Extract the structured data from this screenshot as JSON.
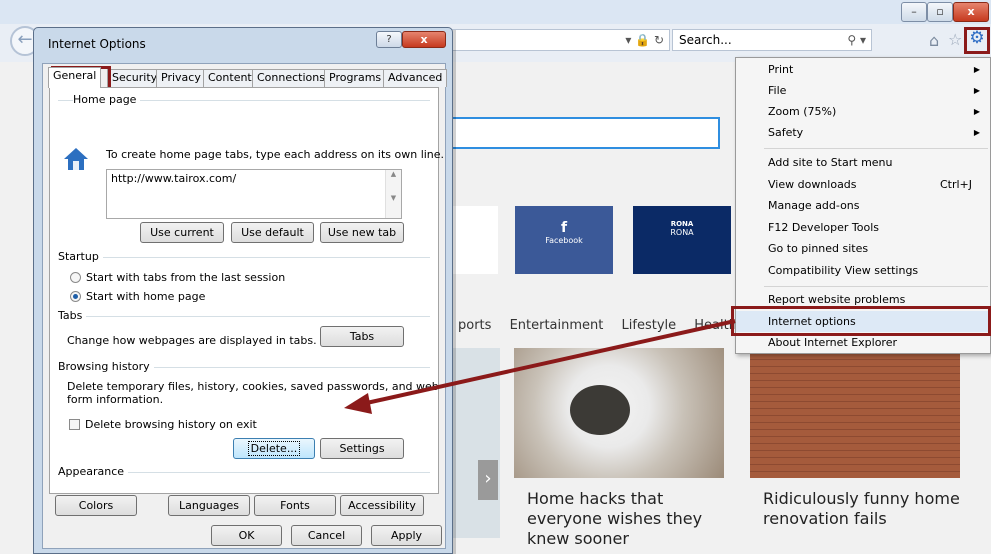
{
  "browser": {
    "window_controls": {
      "minimize": "–",
      "maximize": "▫",
      "close": "x"
    },
    "search_placeholder": "Search...",
    "address_controls": "▾ 🔒 ↻",
    "search_glyph": "⚲ ▾"
  },
  "page": {
    "tiles": [
      {
        "title": "f",
        "label": "Facebook",
        "color": "#3b5998"
      },
      {
        "title": "RONA",
        "label": "RONA",
        "color": "#0b2a66"
      }
    ],
    "categories": [
      "ports",
      "Entertainment",
      "Lifestyle",
      "Health"
    ],
    "cards": [
      {
        "headline": "Home hacks that everyone wishes they knew sooner"
      },
      {
        "headline": "Ridiculously funny home renovation fails"
      }
    ],
    "carousel_arrow": "›"
  },
  "tools_menu": {
    "items": [
      {
        "label": "Print",
        "submenu": true
      },
      {
        "label": "File",
        "submenu": true
      },
      {
        "label": "Zoom (75%)",
        "submenu": true
      },
      {
        "label": "Safety",
        "submenu": true
      },
      {
        "label": "Add site to Start menu"
      },
      {
        "label": "View downloads",
        "shortcut": "Ctrl+J"
      },
      {
        "label": "Manage add-ons"
      },
      {
        "label": "F12 Developer Tools"
      },
      {
        "label": "Go to pinned sites"
      },
      {
        "label": "Compatibility View settings"
      },
      {
        "label": "Report website problems"
      },
      {
        "label": "Internet options",
        "highlighted": true
      },
      {
        "label": "About Internet Explorer"
      }
    ],
    "arrow_glyph": "▶"
  },
  "dialog": {
    "title": "Internet Options",
    "help": "?",
    "close": "x",
    "tabs": [
      "General",
      "Security",
      "Privacy",
      "Content",
      "Connections",
      "Programs",
      "Advanced"
    ],
    "active_tab": "General",
    "home_page": {
      "group_title": "Home page",
      "instruction": "To create home page tabs, type each address on its own line.",
      "value": "http://www.tairox.com/",
      "buttons": [
        "Use current",
        "Use default",
        "Use new tab"
      ]
    },
    "startup": {
      "group_title": "Startup",
      "options": [
        "Start with tabs from the last session",
        "Start with home page"
      ],
      "selected": "Start with home page"
    },
    "tabs_group": {
      "group_title": "Tabs",
      "description": "Change how webpages are displayed in tabs.",
      "button": "Tabs"
    },
    "browsing_history": {
      "group_title": "Browsing history",
      "description_line1": "Delete temporary files, history, cookies, saved passwords, and web",
      "description_line2": "form information.",
      "checkbox": "Delete browsing history on exit",
      "checked": false,
      "buttons": [
        "Delete...",
        "Settings"
      ]
    },
    "appearance": {
      "group_title": "Appearance",
      "buttons": [
        "Colors",
        "Languages",
        "Fonts",
        "Accessibility"
      ]
    },
    "footer_buttons": [
      "OK",
      "Cancel",
      "Apply"
    ]
  },
  "colors": {
    "annotation": "#8b1a1a",
    "ie_blue": "#2d6cc4"
  }
}
